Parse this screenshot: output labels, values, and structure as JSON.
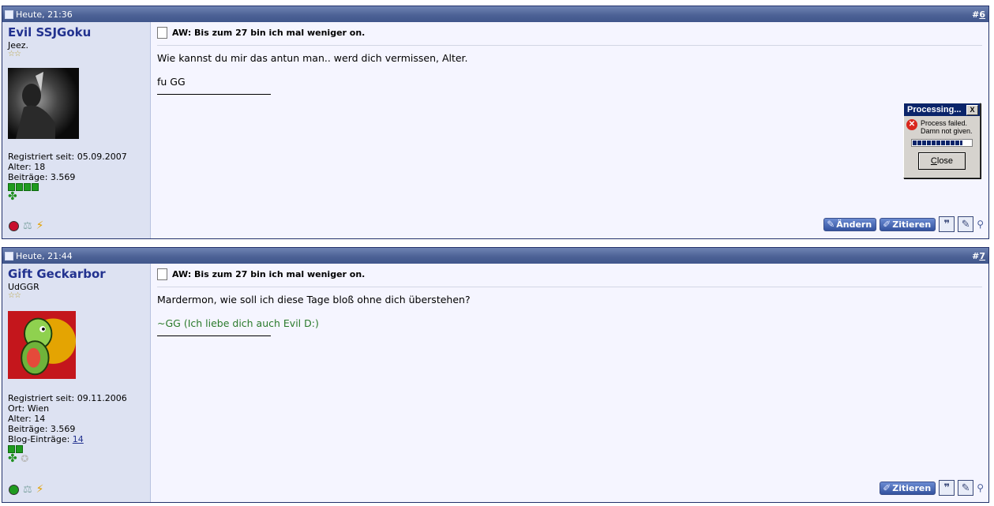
{
  "posts": [
    {
      "date": "Heute, 21:36",
      "number_prefix": "#",
      "number": "6",
      "username": "Evil SSJGoku",
      "user_title": "Jeez.",
      "stars": "☆☆",
      "info": [
        "Registriert seit: 05.09.2007",
        "Alter: 18",
        "Beiträge: 3.569"
      ],
      "online_status_color": "#c8102e",
      "title": "AW: Bis zum 27 bin ich mal weniger on.",
      "message": "Wie kannst du mir das antun man.. werd dich vermissen, Alter.",
      "signature": "fu GG",
      "actions": {
        "edit": "Ändern",
        "quote": "Zitieren"
      }
    },
    {
      "date": "Heute, 21:44",
      "number_prefix": "#",
      "number": "7",
      "username": "Gift Geckarbor",
      "user_title": "UdGGR",
      "stars": "☆☆",
      "info": [
        "Registriert seit: 09.11.2006",
        "Ort: Wien",
        "Alter: 14",
        "Beiträge: 3.569"
      ],
      "blog_label": "Blog-Einträge: ",
      "blog_count": "14",
      "online_status_color": "#1f9b1f",
      "title": "AW: Bis zum 27 bin ich mal weniger on.",
      "message": "Mardermon, wie soll ich diese Tage bloß ohne dich überstehen?",
      "signature": "~GG (Ich liebe dich auch Evil D:)",
      "actions": {
        "quote": "Zitieren"
      }
    }
  ],
  "dialog": {
    "title": "Processing...",
    "close_x": "X",
    "message_line1": "Process failed.",
    "message_line2": "Damn not given.",
    "progress": 0.85,
    "button_rest": "lose",
    "button_underlined": "C"
  }
}
